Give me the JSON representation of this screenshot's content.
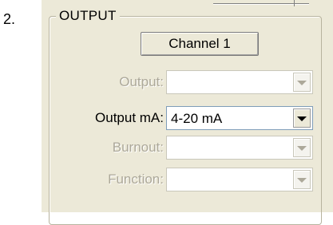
{
  "step_number": "2.",
  "groupbox": {
    "title": "OUTPUT"
  },
  "channel_button": {
    "label": "Channel 1"
  },
  "rows": [
    {
      "label": "Output:",
      "value": "",
      "enabled": false
    },
    {
      "label": "Output mA:",
      "value": "4-20 mA",
      "enabled": true
    },
    {
      "label": "Burnout:",
      "value": "",
      "enabled": false
    },
    {
      "label": "Function:",
      "value": "",
      "enabled": false
    }
  ],
  "icons": {
    "dropdown": "chevron-down-icon"
  }
}
